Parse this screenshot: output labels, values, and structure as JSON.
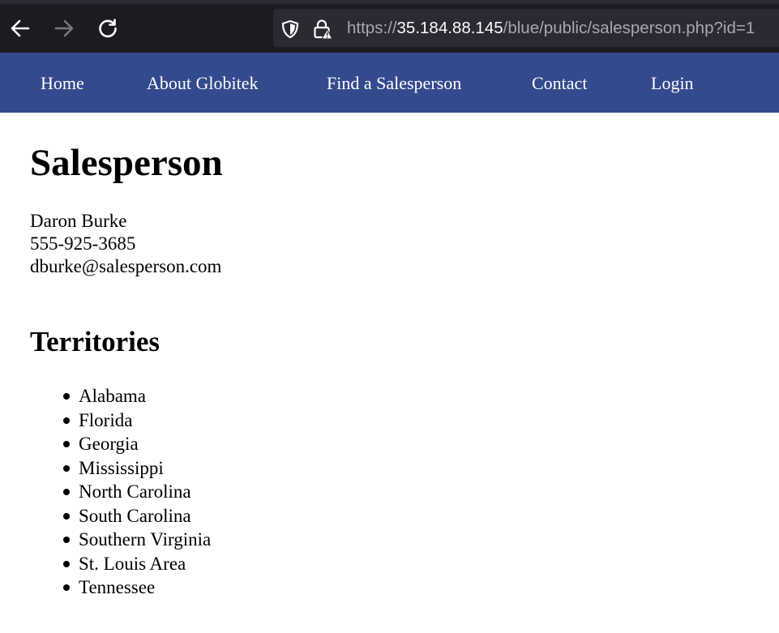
{
  "browser": {
    "url_prefix": "https://",
    "url_host": "35.184.88.145",
    "url_path": "/blue/public/salesperson.php?id=1"
  },
  "nav": {
    "items": [
      {
        "label": "Home"
      },
      {
        "label": "About Globitek"
      },
      {
        "label": "Find a Salesperson"
      },
      {
        "label": "Contact"
      },
      {
        "label": "Login"
      }
    ]
  },
  "page": {
    "title": "Salesperson",
    "salesperson": {
      "name": "Daron Burke",
      "phone": "555-925-3685",
      "email": "dburke@salesperson.com"
    },
    "territories_heading": "Territories",
    "territories": [
      "Alabama",
      "Florida",
      "Georgia",
      "Mississippi",
      "North Carolina",
      "South Carolina",
      "Southern Virginia",
      "St. Louis Area",
      "Tennessee"
    ]
  },
  "colors": {
    "chrome_background": "#1c1b22",
    "urlbar_background": "#2b2a33",
    "nav_background": "#344a8e",
    "nav_text": "#ffffff",
    "page_text": "#000000"
  },
  "icons": {
    "back": "arrow-left-icon",
    "forward": "arrow-right-icon",
    "reload": "reload-icon",
    "tracking": "shield-icon",
    "security": "lock-warning-icon"
  }
}
